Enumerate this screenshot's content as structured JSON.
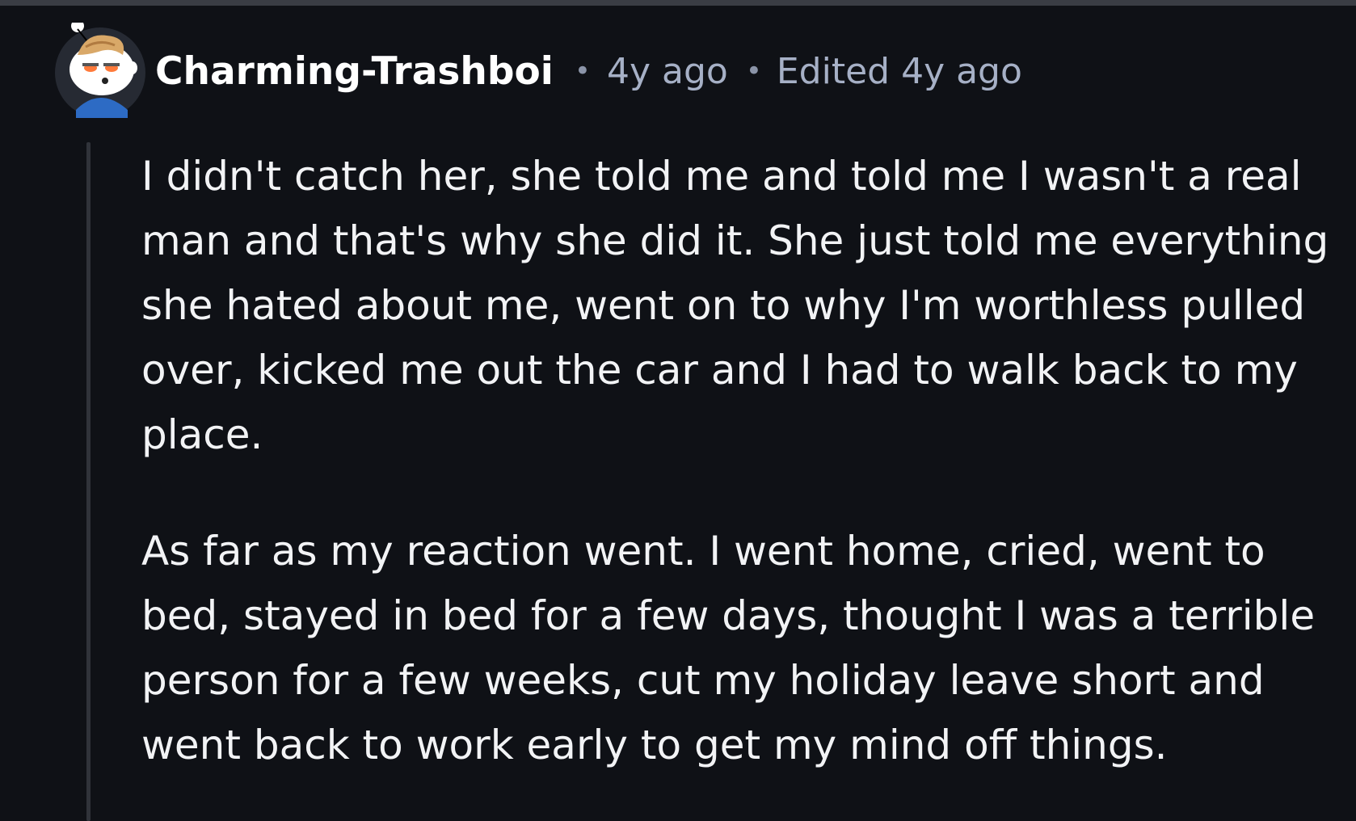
{
  "comment": {
    "author": "Charming-Trashboi",
    "separator": "•",
    "age": "4y ago",
    "edited": "Edited 4y ago",
    "avatar_icon": "snoo-avatar-icon",
    "paragraphs": [
      "I didn't catch her, she told me and told me I wasn't a real man and that's why she did it. She just told me everything she hated about me, went on to why I'm worthless pulled over, kicked me out the car and I had to walk back to my place.",
      "As far as my reaction went. I went home, cried, went to bed, stayed in bed for a few days, thought I was a terrible person for a few weeks, cut my holiday leave short and went back to work early to get my mind off things."
    ]
  },
  "colors": {
    "background": "#0f1116",
    "username": "#ffffff",
    "meta": "#a6b0c6",
    "body_text": "#f2f3f5",
    "thread_line": "#30333a",
    "avatar_shirt": "#2d6bc4"
  }
}
